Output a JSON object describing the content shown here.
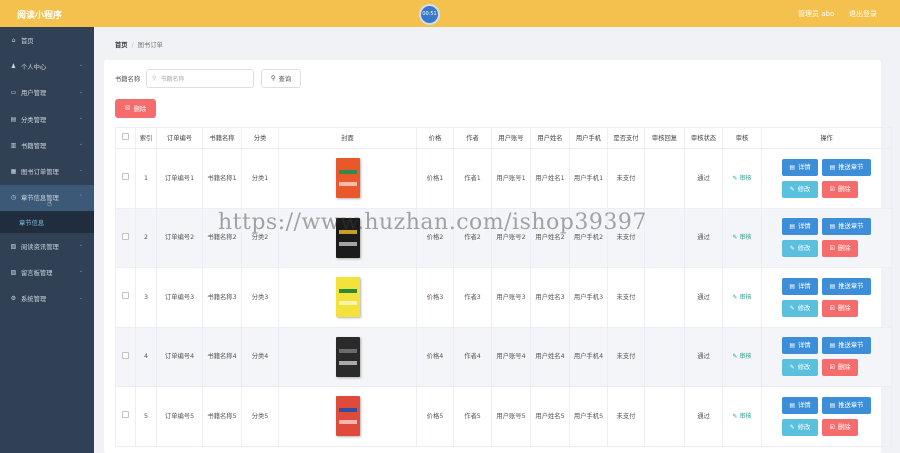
{
  "app": {
    "title": "阅读小程序",
    "clock": "00:51",
    "user": "管理员 abo",
    "logout": "退出登录"
  },
  "sidebar": {
    "items": [
      {
        "label": "首页",
        "icon": "home-icon",
        "glyph": "⌂"
      },
      {
        "label": "个人中心",
        "icon": "user-icon",
        "glyph": "♟"
      },
      {
        "label": "用户管理",
        "icon": "users-icon",
        "glyph": "▭"
      },
      {
        "label": "分类管理",
        "icon": "category-icon",
        "glyph": "▤"
      },
      {
        "label": "书籍管理",
        "icon": "book-icon",
        "glyph": "▥"
      },
      {
        "label": "图书订单管理",
        "icon": "order-icon",
        "glyph": "▦"
      },
      {
        "label": "章节信息管理",
        "icon": "chapter-icon",
        "glyph": "◷"
      },
      {
        "label": "阅读资讯管理",
        "icon": "news-icon",
        "glyph": "▧"
      },
      {
        "label": "留言板管理",
        "icon": "message-icon",
        "glyph": "▨"
      },
      {
        "label": "系统管理",
        "icon": "settings-icon",
        "glyph": "⚙"
      }
    ],
    "submenu_label": "章节信息"
  },
  "breadcrumb": {
    "home": "首页",
    "separator": "/",
    "current": "图书订单"
  },
  "search": {
    "label": "书籍名称",
    "placeholder": "书籍名称",
    "query_label": "查询"
  },
  "toolbar": {
    "delete_label": "删除"
  },
  "table": {
    "headers": [
      "",
      "索引",
      "订单编号",
      "书籍名称",
      "分类",
      "封面",
      "价格",
      "作者",
      "用户账号",
      "用户姓名",
      "用户手机",
      "是否支付",
      "审核回复",
      "审核状态",
      "审核",
      "操作"
    ],
    "rows": [
      {
        "index": "1",
        "order": "订单编号1",
        "book": "书籍名称1",
        "category": "分类1",
        "price": "价格1",
        "author": "作者1",
        "account": "用户账号1",
        "name": "用户姓名1",
        "phone": "用户手机1",
        "paid": "未支付",
        "reply": "",
        "status": "通过",
        "review": "审核"
      },
      {
        "index": "2",
        "order": "订单编号2",
        "book": "书籍名称2",
        "category": "分类2",
        "price": "价格2",
        "author": "作者2",
        "account": "用户账号2",
        "name": "用户姓名2",
        "phone": "用户手机2",
        "paid": "未支付",
        "reply": "",
        "status": "通过",
        "review": "审核"
      },
      {
        "index": "3",
        "order": "订单编号3",
        "book": "书籍名称3",
        "category": "分类3",
        "price": "价格3",
        "author": "作者3",
        "account": "用户账号3",
        "name": "用户姓名3",
        "phone": "用户手机3",
        "paid": "未支付",
        "reply": "",
        "status": "通过",
        "review": "审核"
      },
      {
        "index": "4",
        "order": "订单编号4",
        "book": "书籍名称4",
        "category": "分类4",
        "price": "价格4",
        "author": "作者4",
        "account": "用户账号4",
        "name": "用户姓名4",
        "phone": "用户手机4",
        "paid": "未支付",
        "reply": "",
        "status": "通过",
        "review": "审核"
      },
      {
        "index": "5",
        "order": "订单编号5",
        "book": "书籍名称5",
        "category": "分类5",
        "price": "价格5",
        "author": "作者5",
        "account": "用户账号5",
        "name": "用户姓名5",
        "phone": "用户手机5",
        "paid": "未支付",
        "reply": "",
        "status": "通过",
        "review": "审核"
      }
    ],
    "actions": {
      "detail": "详情",
      "send": "推送章节",
      "edit": "修改",
      "delete": "删除"
    }
  },
  "watermark": "https://www.huzhan.com/ishop39397",
  "colors": {
    "topbar": "#f5c14e",
    "sidebar": "#304156",
    "primary": "#3c8ed8",
    "danger": "#f56c6c",
    "info": "#5bc0de"
  }
}
